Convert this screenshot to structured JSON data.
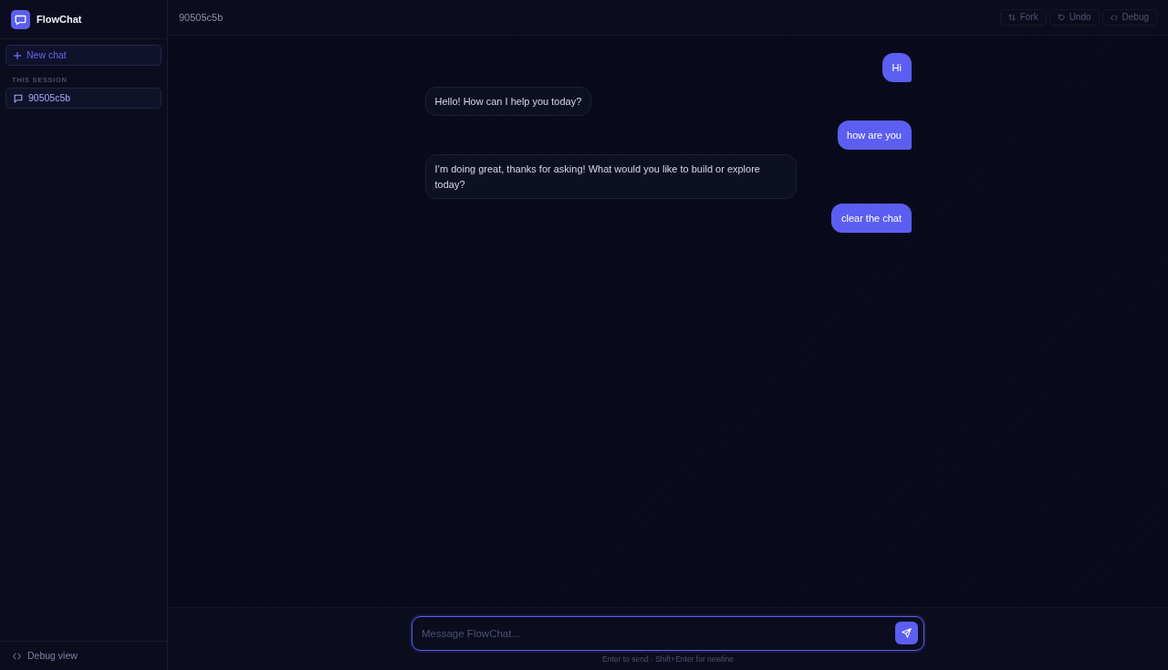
{
  "app": {
    "name": "FlowChat"
  },
  "sidebar": {
    "new_chat_button": "New chat",
    "section_label": "THIS SESSION",
    "sessions": [
      {
        "label": "90505c5b",
        "selected": true
      }
    ],
    "footer_link": "Debug view"
  },
  "header": {
    "title": "90505c5b",
    "actions": [
      {
        "kind": "fork",
        "label": "Fork",
        "disabled": true
      },
      {
        "kind": "undo",
        "label": "Undo",
        "disabled": true
      },
      {
        "kind": "debug",
        "label": "Debug",
        "disabled": true
      }
    ]
  },
  "messages": [
    {
      "kind": "user",
      "text": "Hi"
    },
    {
      "kind": "assistant",
      "text": "Hello! How can I help you today?"
    },
    {
      "kind": "user",
      "text": "how are you"
    },
    {
      "kind": "assistant",
      "text": "I’m doing great, thanks for asking! What would you like to build or explore today?"
    },
    {
      "kind": "user",
      "text": "clear the chat"
    }
  ],
  "composer": {
    "placeholder": "Message FlowChat...",
    "focused": true,
    "hint": "Enter to send · Shift+Enter for newline"
  }
}
